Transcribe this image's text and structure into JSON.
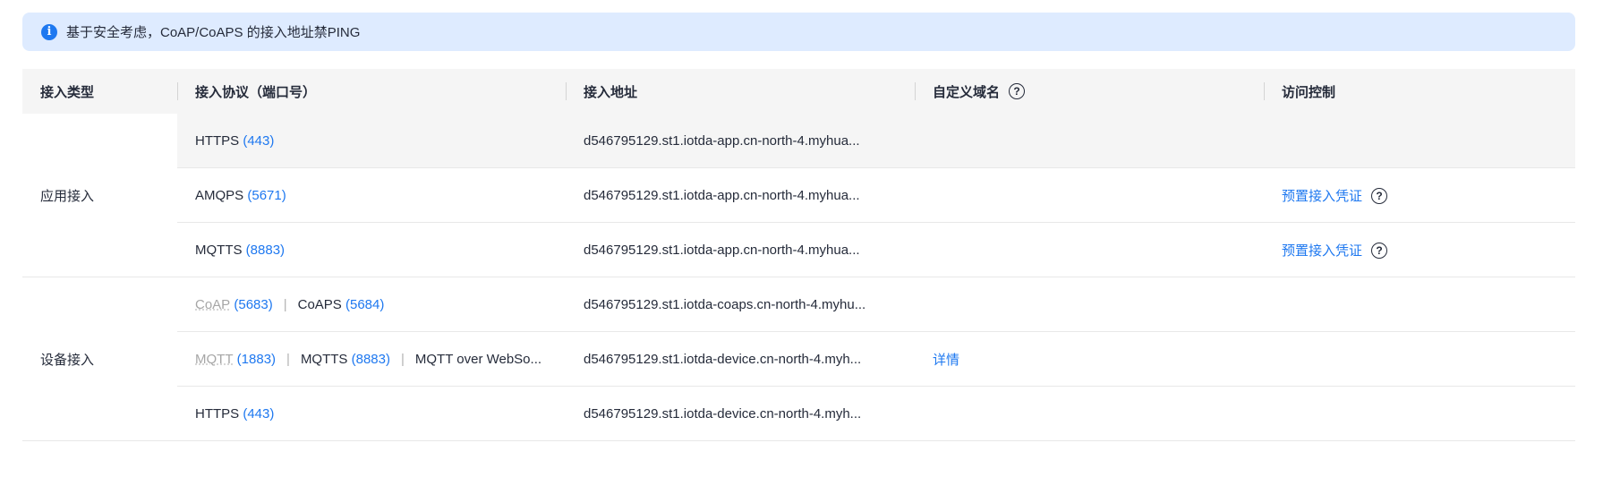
{
  "notice": {
    "text": "基于安全考虑，CoAP/CoAPS 的接入地址禁PING"
  },
  "columns": {
    "type": "接入类型",
    "protocol": "接入协议（端口号）",
    "address": "接入地址",
    "domain": "自定义域名",
    "access": "访问控制"
  },
  "groups": {
    "app": "应用接入",
    "device": "设备接入"
  },
  "rows": [
    {
      "p1": "HTTPS",
      "p1_port": "(443)",
      "address": "d546795129.st1.iotda-app.cn-north-4.myhua..."
    },
    {
      "p1": "AMQPS",
      "p1_port": "(5671)",
      "address": "d546795129.st1.iotda-app.cn-north-4.myhua...",
      "access": "预置接入凭证"
    },
    {
      "p1": "MQTTS",
      "p1_port": "(8883)",
      "address": "d546795129.st1.iotda-app.cn-north-4.myhua...",
      "access": "预置接入凭证"
    },
    {
      "p1": "CoAP",
      "p1_port": "(5683)",
      "p2": "CoAPS",
      "p2_port": "(5684)",
      "address": "d546795129.st1.iotda-coaps.cn-north-4.myhu..."
    },
    {
      "p1": "MQTT",
      "p1_port": "(1883)",
      "p2": "MQTTS",
      "p2_port": "(8883)",
      "p3": "MQTT over WebSo...",
      "address": "d546795129.st1.iotda-device.cn-north-4.myh...",
      "domain": "详情"
    },
    {
      "p1": "HTTPS",
      "p1_port": "(443)",
      "address": "d546795129.st1.iotda-device.cn-north-4.myh..."
    }
  ],
  "icons": {
    "info": "info-icon",
    "help": "question-circle-icon"
  },
  "colors": {
    "accent": "#1e78f0",
    "notice_bg": "#deebff",
    "header_bg": "#f5f5f5"
  }
}
